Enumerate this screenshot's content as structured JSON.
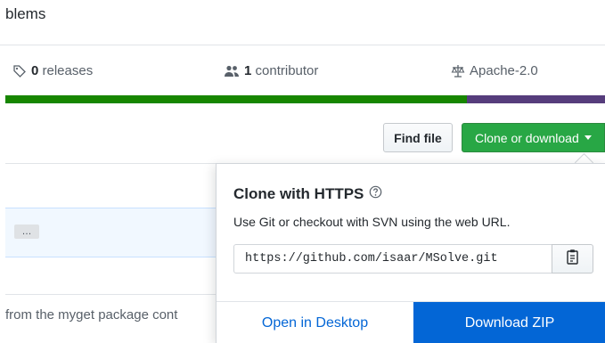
{
  "repo": {
    "description": "blems"
  },
  "stats": {
    "releases_count": "0",
    "releases_label": " releases",
    "contributors_count": "1",
    "contributors_label": " contributor",
    "license": "Apache-2.0"
  },
  "language_bar": [
    {
      "color": "#178600",
      "fraction": 0.77
    },
    {
      "color": "#563d7c",
      "fraction": 0.23
    }
  ],
  "toolbar": {
    "find_file_label": "Find file",
    "clone_label": "Clone or download"
  },
  "file_list": {
    "ellipsis_label": "…"
  },
  "readme": {
    "snippet": "from the myget package cont"
  },
  "clone_dropdown": {
    "title": "Clone with HTTPS",
    "subtitle": "Use Git or checkout with SVN using the web URL.",
    "url": "https://github.com/isaar/MSolve.git",
    "open_desktop_label": "Open in Desktop",
    "download_zip_label": "Download ZIP"
  },
  "colors": {
    "clone_button": "#28a745",
    "download_button": "#0366d6",
    "link": "#0366d6"
  }
}
